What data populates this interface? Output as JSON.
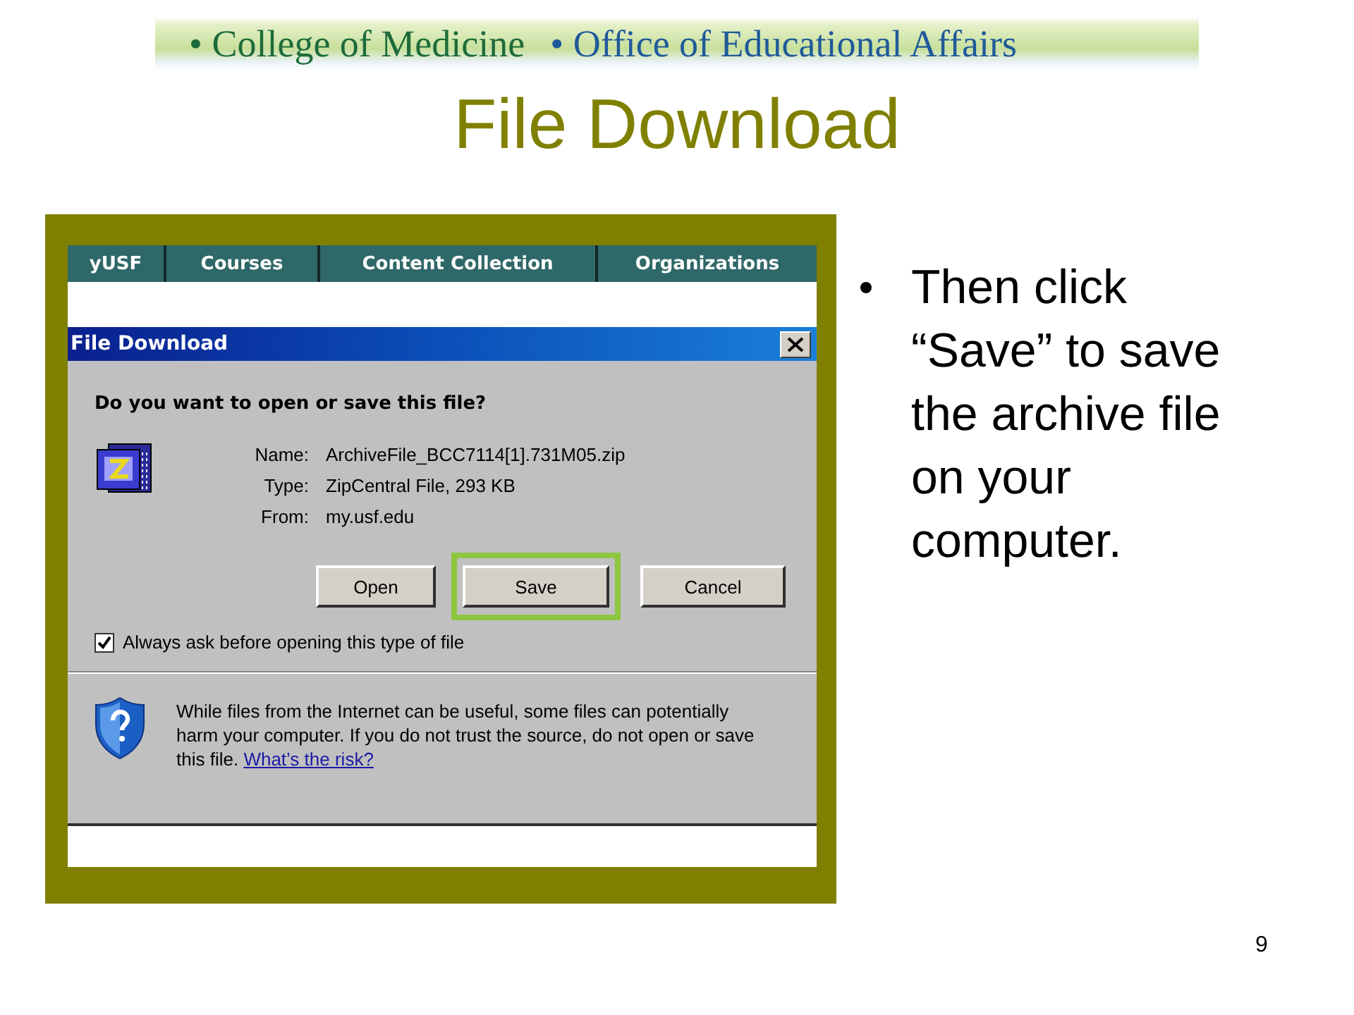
{
  "banner": {
    "items": [
      "• College of Medicine",
      "• Office of Educational Affairs"
    ]
  },
  "title": "File Download",
  "screenshot": {
    "nav_tabs": [
      "yUSF",
      "Courses",
      "Content Collection",
      "Organizations"
    ],
    "dialog": {
      "title": "File Download",
      "question": "Do you want to open or save this file?",
      "fields": [
        {
          "label": "Name:",
          "value": "ArchiveFile_BCC7114[1].731M05.zip"
        },
        {
          "label": "Type:",
          "value": "ZipCentral File, 293 KB"
        },
        {
          "label": "From:",
          "value": "my.usf.edu"
        }
      ],
      "buttons": [
        {
          "label": "Open",
          "highlighted": false
        },
        {
          "label": "Save",
          "highlighted": true
        },
        {
          "label": "Cancel",
          "highlighted": false
        }
      ],
      "checkbox": {
        "label": "Always ask before opening this type of file",
        "checked": true
      },
      "warning": {
        "text": "While files from the Internet can be useful, some files can potentially harm your computer. If you do not trust the source, do not open or save this file.",
        "link": "What’s the risk?"
      }
    }
  },
  "bullets": [
    "Then click “Save” to save the archive file on your computer."
  ],
  "page_number": "9"
}
